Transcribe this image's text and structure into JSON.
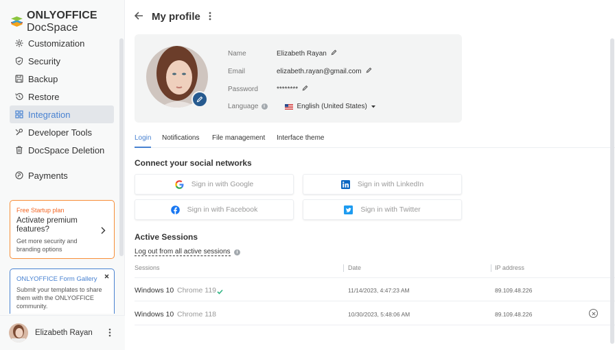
{
  "app": {
    "logo_brand": "ONLYOFFICE",
    "logo_product": " DocSpace"
  },
  "sidebar": {
    "items": [
      {
        "label": "Customization",
        "icon": "gear-icon"
      },
      {
        "label": "Security",
        "icon": "shield-icon"
      },
      {
        "label": "Backup",
        "icon": "save-icon"
      },
      {
        "label": "Restore",
        "icon": "history-icon"
      },
      {
        "label": "Integration",
        "icon": "grid-icon",
        "active": true
      },
      {
        "label": "Developer Tools",
        "icon": "tools-icon"
      },
      {
        "label": "DocSpace Deletion",
        "icon": "trash-icon"
      },
      {
        "label": "Payments",
        "icon": "payment-icon"
      }
    ],
    "promo": {
      "tag": "Free Startup plan",
      "title": "Activate premium features?",
      "subtitle": "Get more security and branding options"
    },
    "gallery": {
      "title": "ONLYOFFICE Form Gallery",
      "subtitle": "Submit your templates to share them with the ONLYOFFICE community."
    },
    "user": {
      "name": "Elizabeth Rayan"
    }
  },
  "header": {
    "title": "My profile"
  },
  "profile": {
    "name_label": "Name",
    "name_value": "Elizabeth Rayan",
    "email_label": "Email",
    "email_value": "elizabeth.rayan@gmail.com",
    "password_label": "Password",
    "password_value": "********",
    "language_label": "Language",
    "language_value": "English (United States)"
  },
  "tabs": [
    "Login",
    "Notifications",
    "File management",
    "Interface theme"
  ],
  "social": {
    "title": "Connect your social networks",
    "google": "Sign in with Google",
    "linkedin": "Sign in with LinkedIn",
    "facebook": "Sign in with Facebook",
    "twitter": "Sign in with Twitter"
  },
  "sessions": {
    "title": "Active Sessions",
    "logout_all": "Log out from all active sessions",
    "columns": [
      "Sessions",
      "Date",
      "IP address"
    ],
    "rows": [
      {
        "os": "Windows 10",
        "browser": "Chrome 119",
        "date": "11/14/2023, 4:47:23 AM",
        "ip": "89.109.48.226",
        "current": true
      },
      {
        "os": "Windows 10",
        "browser": "Chrome 118",
        "date": "10/30/2023, 5:48:06 AM",
        "ip": "89.109.48.226",
        "current": false
      }
    ]
  },
  "colors": {
    "accent": "#4781d1",
    "promo_border": "#f78c35",
    "edit_button": "#265a8f",
    "check": "#2db482"
  }
}
